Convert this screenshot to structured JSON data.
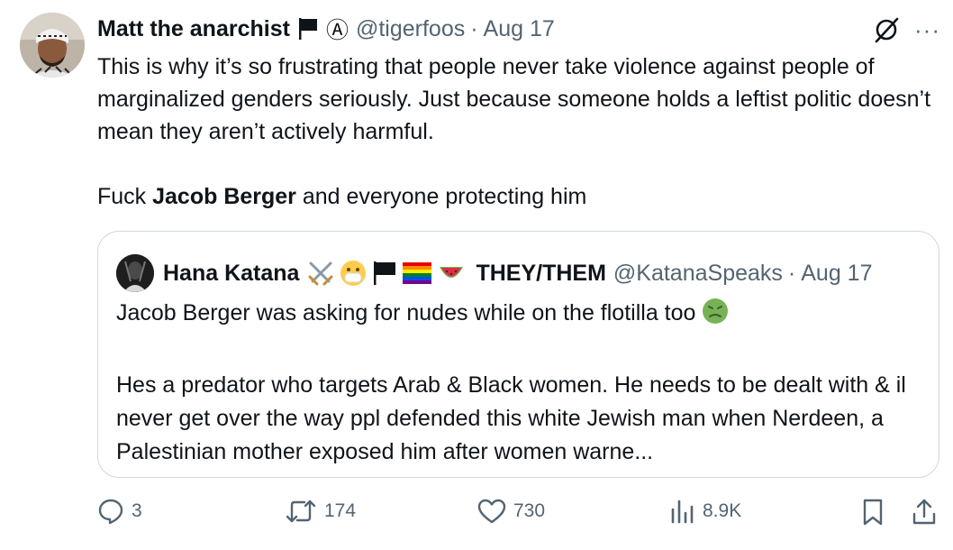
{
  "tweet": {
    "author_name": "Matt the anarchist",
    "author_flag_icon": "black-flag-icon",
    "author_symbol": "Ⓐ",
    "handle": "@tigerfoos",
    "separator": "·",
    "date": "Aug 17",
    "text_line1_part1": "This is why it’s so frustrating that people never take violence against people of marginalized genders seriously. Just because someone holds a leftist politic doesn’t mean they aren’t actively harmful.",
    "text_line2_prefix": "Fuck ",
    "text_line2_bold": "Jacob Berger",
    "text_line2_suffix": " and everyone protecting him"
  },
  "quote": {
    "author_name": "Hana Katana",
    "emoji_icons": [
      "crossed-swords-icon",
      "mask-face-icon",
      "black-flag-icon",
      "rainbow-flag-icon",
      "watermelon-icon"
    ],
    "pronouns": "THEY/THEM",
    "handle": "@KatanaSpeaks",
    "separator": "·",
    "date": "Aug 17",
    "text_para1": "Jacob Berger was asking for nudes while on the flotilla too",
    "text_para1_emoji": "nauseated-face-icon",
    "text_para2": "Hes a predator who targets Arab & Black women. He needs to be dealt with & il never get over the way ppl defended this white Jewish man when Nerdeen, a Palestinian mother exposed him after women warne..."
  },
  "actions": {
    "replies": "3",
    "reposts": "174",
    "likes": "730",
    "views": "8.9K"
  },
  "colors": {
    "text": "#0f1419",
    "secondary": "#536471",
    "border": "#cfd9de"
  }
}
